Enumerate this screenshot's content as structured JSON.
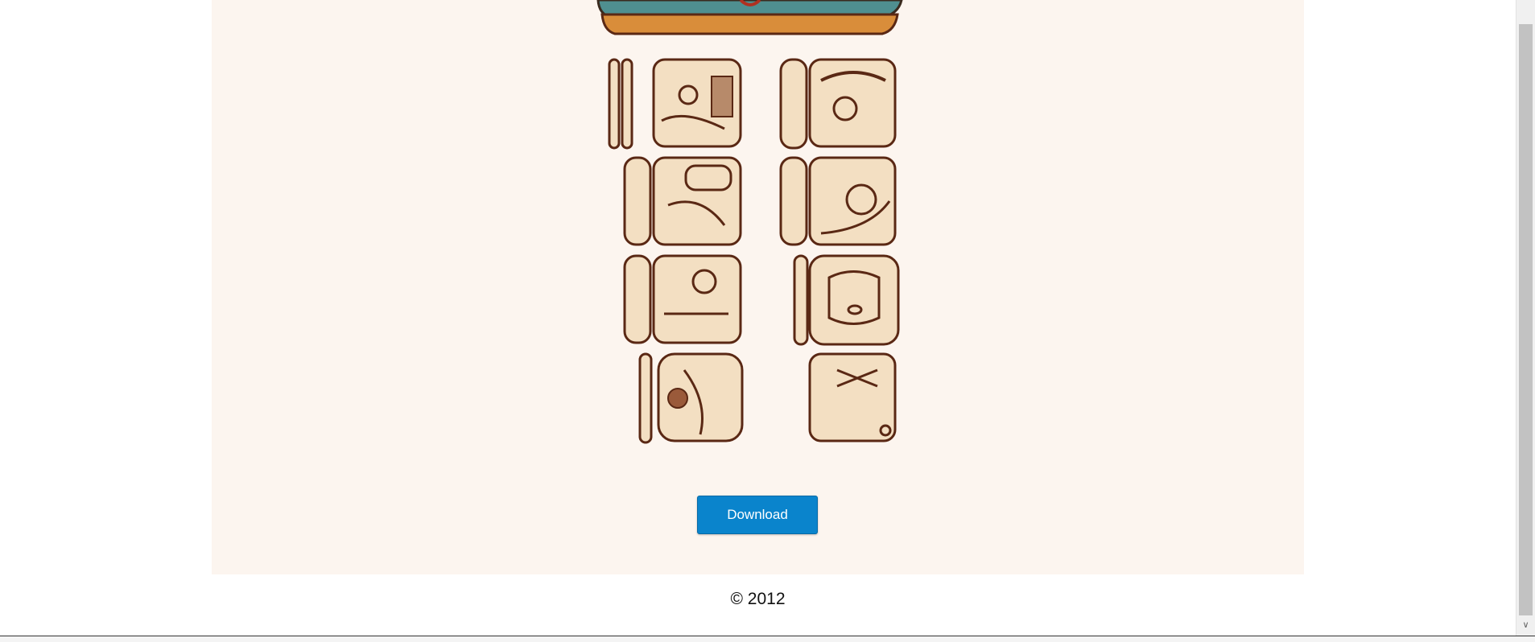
{
  "main": {
    "download_label": "Download",
    "illustration_icon": "mayan-glyphs-illustration"
  },
  "footer": {
    "copyright": "© 2012"
  },
  "scrollbar": {
    "down_arrow_icon": "chevron-down-icon"
  },
  "colors": {
    "panel_bg": "#fcf5ef",
    "button_blue": "#0a84cc",
    "glyph_fill": "#f3dfc2",
    "glyph_ink": "#5a2814",
    "teal": "#4f8f90"
  }
}
